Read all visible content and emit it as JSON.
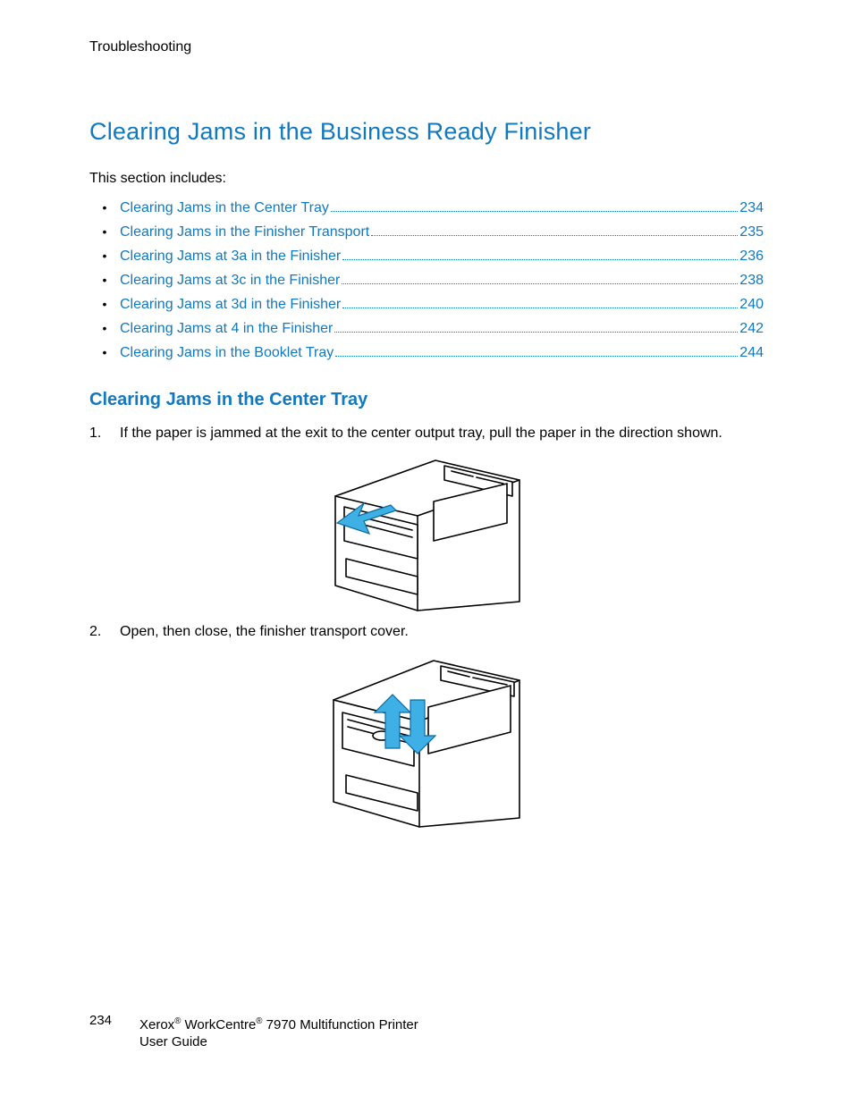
{
  "header": {
    "section": "Troubleshooting"
  },
  "heading": "Clearing Jams in the Business Ready Finisher",
  "intro": "This section includes:",
  "toc": [
    {
      "title": "Clearing Jams in the Center Tray",
      "page": "234"
    },
    {
      "title": "Clearing Jams in the Finisher Transport",
      "page": "235"
    },
    {
      "title": "Clearing Jams at 3a in the Finisher",
      "page": "236"
    },
    {
      "title": "Clearing Jams at 3c in the Finisher",
      "page": "238"
    },
    {
      "title": "Clearing Jams at 3d in the Finisher",
      "page": "240"
    },
    {
      "title": "Clearing Jams at 4 in the Finisher",
      "page": "242"
    },
    {
      "title": "Clearing Jams in the Booklet Tray",
      "page": "244"
    }
  ],
  "subheading": "Clearing Jams in the Center Tray",
  "steps": [
    {
      "n": "1.",
      "text": "If the paper is jammed at the exit to the center output tray, pull the paper in the direction shown."
    },
    {
      "n": "2.",
      "text": "Open, then close, the finisher transport cover."
    }
  ],
  "footer": {
    "page_number": "234",
    "line1_a": "Xerox",
    "line1_b": " WorkCentre",
    "line1_c": " 7970 Multifunction Printer",
    "line2": "User Guide"
  }
}
